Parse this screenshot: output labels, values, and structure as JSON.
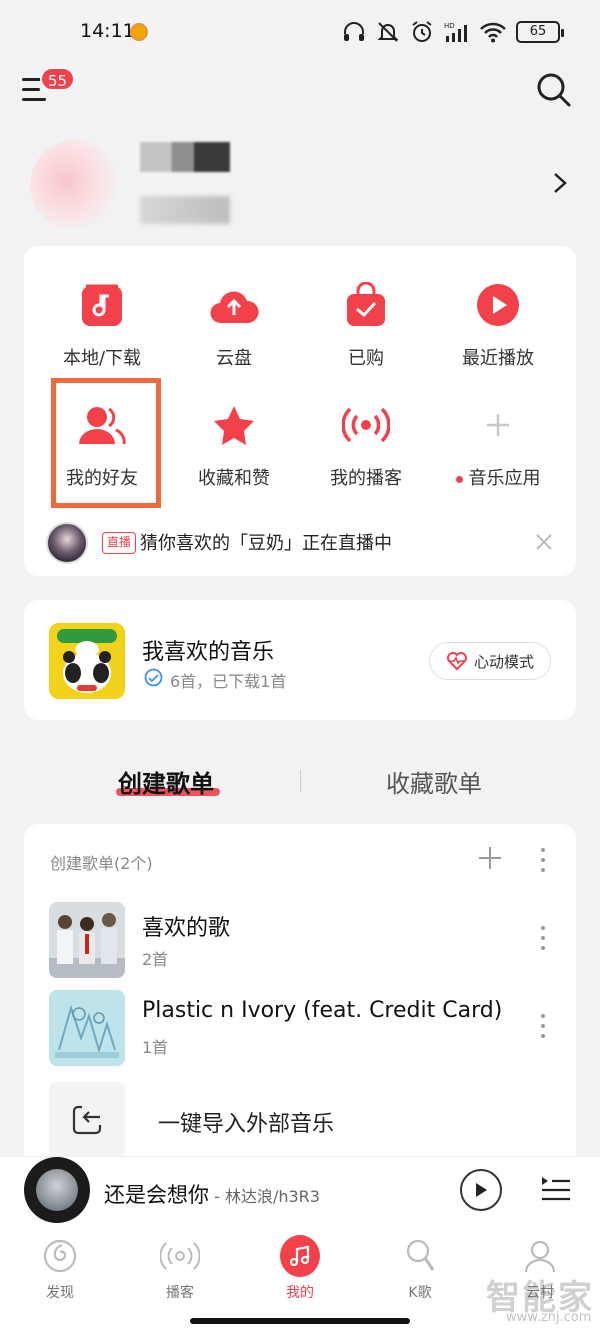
{
  "status_bar": {
    "time": "14:11",
    "battery": "65",
    "network": "HD"
  },
  "header": {
    "badge_count": "55",
    "icons": [
      "menu-icon",
      "search-icon"
    ]
  },
  "shortcuts": [
    {
      "label": "本地/下载",
      "icon": "local-music-icon"
    },
    {
      "label": "云盘",
      "icon": "cloud-upload-icon"
    },
    {
      "label": "已购",
      "icon": "purchased-bag-icon"
    },
    {
      "label": "最近播放",
      "icon": "recent-play-icon"
    },
    {
      "label": "我的好友",
      "icon": "friends-icon"
    },
    {
      "label": "收藏和赞",
      "icon": "star-icon"
    },
    {
      "label": "我的播客",
      "icon": "podcast-icon"
    },
    {
      "label": "音乐应用",
      "icon": "add-icon"
    }
  ],
  "live_banner": {
    "tag": "直播",
    "text": "猜你喜欢的「豆奶」正在直播中"
  },
  "liked_music": {
    "title": "我喜欢的音乐",
    "subtitle": "6首，已下载1首",
    "mode_button": "心动模式"
  },
  "tabs": {
    "active": "创建歌单",
    "inactive": "收藏歌单"
  },
  "playlists": {
    "header": "创建歌单(2个)",
    "items": [
      {
        "name": "喜欢的歌",
        "count": "2首"
      },
      {
        "name": "Plastic n Ivory (feat. Credit Card)",
        "count": "1首"
      }
    ],
    "import_label": "一键导入外部音乐"
  },
  "now_playing": {
    "title": "还是会想你",
    "artist": " - 林达浪/h3R3"
  },
  "bottom_nav": [
    {
      "label": "发现",
      "icon": "discover-icon"
    },
    {
      "label": "播客",
      "icon": "podcast-icon"
    },
    {
      "label": "我的",
      "icon": "music-note-icon",
      "active": true
    },
    {
      "label": "K歌",
      "icon": "microphone-icon"
    },
    {
      "label": "云村",
      "icon": "community-icon"
    }
  ],
  "watermark": {
    "text": "智能家",
    "url": "www.znj.com"
  },
  "colors": {
    "accent": "#f2414a",
    "highlight_box": "#ef6a3a",
    "background": "#f2f2f4"
  }
}
